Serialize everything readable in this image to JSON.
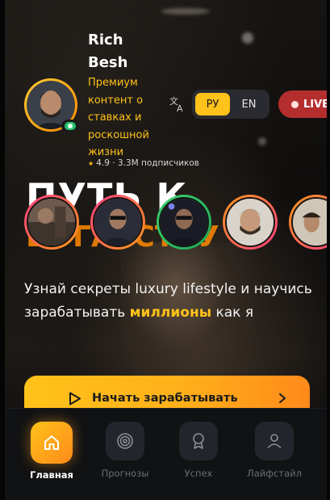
{
  "profile": {
    "name": "Rich Besh",
    "tagline": "Премиум контент о ставках и роскошной жизни",
    "rating": "4.9 · 3.3M подписчиков"
  },
  "language": {
    "options": [
      "РУ",
      "EN"
    ],
    "selected": "РУ"
  },
  "live": {
    "label": "LIVE"
  },
  "hero": {
    "title_line1": "ПУТЬ К",
    "title_line2": "БОГАТСТВУ",
    "subtitle_pre": "Узнай секреты luxury lifestyle и научись зарабатывать ",
    "subtitle_highlight": "миллионы",
    "subtitle_post": " как я"
  },
  "stories": [
    {
      "name": "story-1",
      "ring": "gradient-pink"
    },
    {
      "name": "story-2",
      "ring": "gradient-pink"
    },
    {
      "name": "story-3",
      "ring": "green"
    },
    {
      "name": "story-4",
      "ring": "gradient-pink"
    },
    {
      "name": "story-5",
      "ring": "gradient-pink"
    }
  ],
  "cta": {
    "label": "Начать зарабатывать",
    "icon": "play-icon"
  },
  "nav": {
    "items": [
      {
        "label": "Главная",
        "icon": "home-icon",
        "active": true
      },
      {
        "label": "Прогнозы",
        "icon": "target-icon",
        "active": false
      },
      {
        "label": "Успех",
        "icon": "award-icon",
        "active": false
      },
      {
        "label": "Лайфстайл",
        "icon": "user-icon",
        "active": false
      }
    ]
  },
  "colors": {
    "accent": "#ffc21a",
    "accent_end": "#ff8a1a",
    "live": "#b52e2e",
    "online": "#25c36b",
    "nav_bg": "#111214"
  }
}
